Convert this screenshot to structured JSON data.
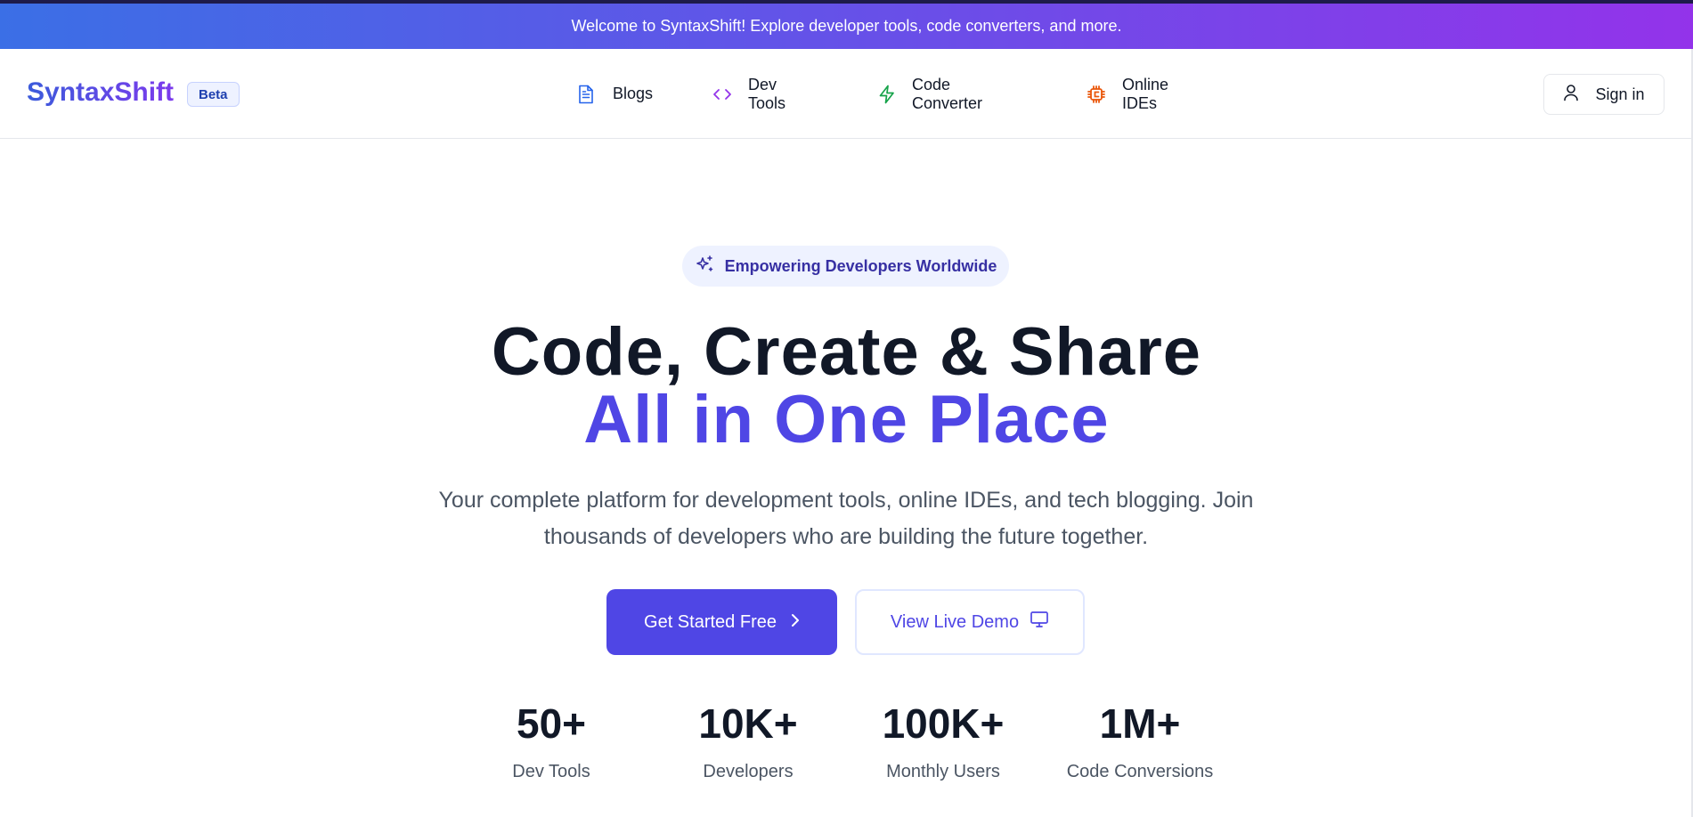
{
  "announcement": {
    "text": "Welcome to SyntaxShift! Explore developer tools, code converters, and more."
  },
  "header": {
    "logo": "SyntaxShift",
    "badge": "Beta",
    "nav": [
      {
        "label": "Blogs",
        "icon": "document-icon",
        "color": "#2563eb"
      },
      {
        "label": "Dev Tools",
        "icon": "code-icon",
        "color": "#9333ea"
      },
      {
        "label": "Code Converter",
        "icon": "lightning-icon",
        "color": "#16a34a"
      },
      {
        "label": "Online IDEs",
        "icon": "cpu-icon",
        "color": "#ea580c"
      }
    ],
    "signin": {
      "label": "Sign in",
      "icon": "user-icon"
    }
  },
  "hero": {
    "pill": {
      "label": "Empowering Developers Worldwide",
      "icon": "sparkles-icon"
    },
    "title_line1": "Code, Create & Share",
    "title_line2": "All in One Place",
    "subtitle": "Your complete platform for development tools, online IDEs, and tech blogging. Join thousands of developers who are building the future together.",
    "primary_cta": {
      "label": "Get Started Free",
      "icon": "chevron-right-icon"
    },
    "secondary_cta": {
      "label": "View Live Demo",
      "icon": "monitor-icon"
    }
  },
  "stats": [
    {
      "value": "50+",
      "label": "Dev Tools"
    },
    {
      "value": "10K+",
      "label": "Developers"
    },
    {
      "value": "100K+",
      "label": "Monthly Users"
    },
    {
      "value": "1M+",
      "label": "Code Conversions"
    }
  ],
  "colors": {
    "accent": "#4f46e5",
    "heading": "#111827",
    "muted": "#4b5563"
  }
}
